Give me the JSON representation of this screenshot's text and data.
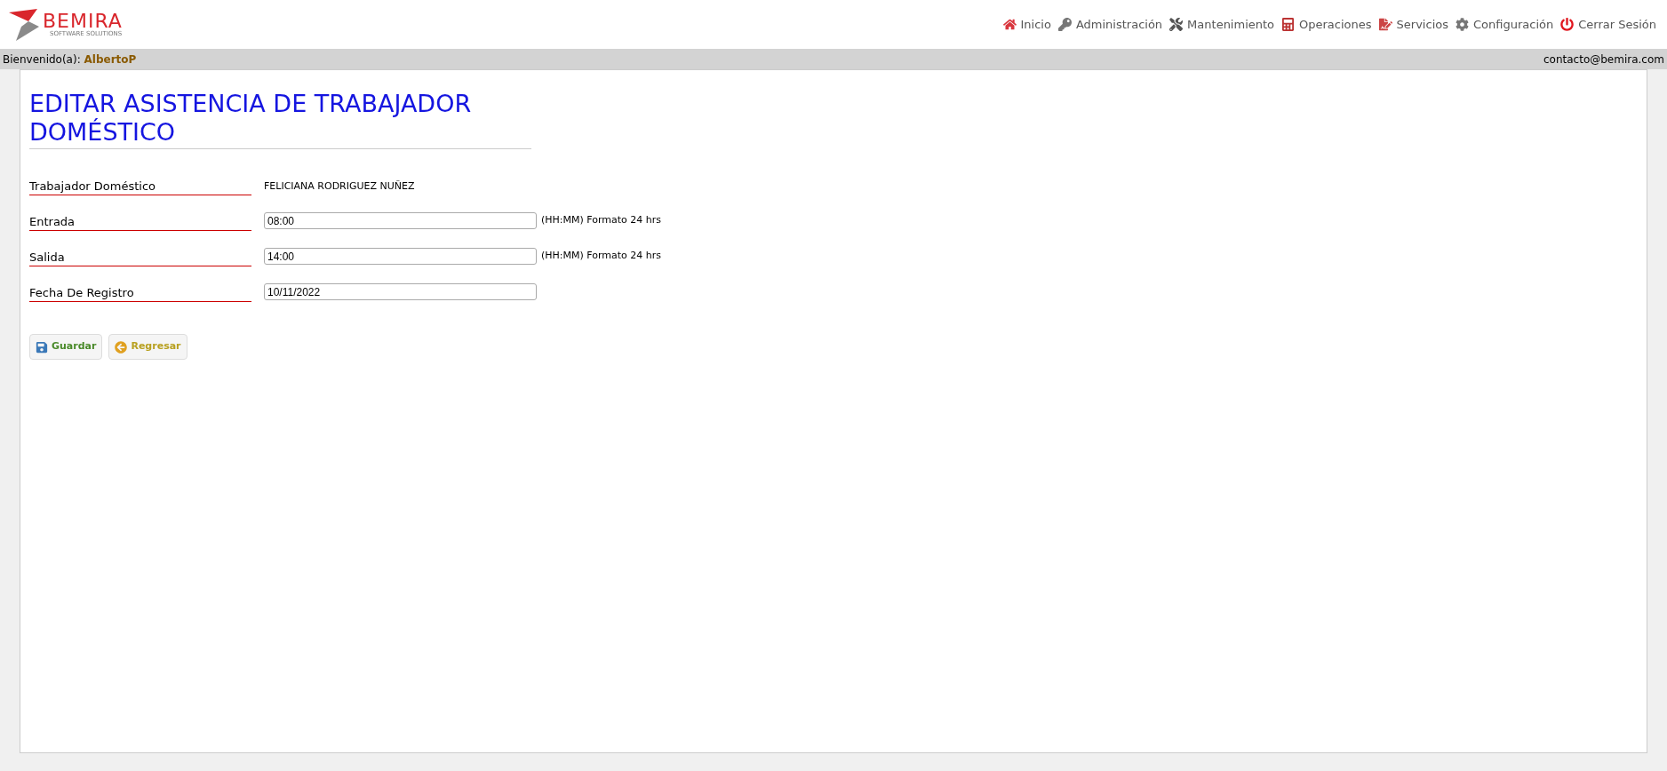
{
  "logo": {
    "name": "BEMIRA",
    "tagline": "SOFTWARE SOLUTIONS"
  },
  "nav": [
    {
      "label": "Inicio"
    },
    {
      "label": "Administración"
    },
    {
      "label": "Mantenimiento"
    },
    {
      "label": "Operaciones"
    },
    {
      "label": "Servicios"
    },
    {
      "label": "Configuración"
    },
    {
      "label": "Cerrar Sesión"
    }
  ],
  "user_bar": {
    "greeting": "Bienvenido(a):",
    "user": "AlbertoP",
    "email": "contacto@bemira.com"
  },
  "title": "EDITAR ASISTENCIA DE TRABAJADOR DOMÉSTICO",
  "fields": [
    {
      "kind": "text",
      "label": "Trabajador Doméstico",
      "value": "FELICIANA RODRIGUEZ NUÑEZ"
    },
    {
      "kind": "input",
      "label": "Entrada",
      "value": "08:00",
      "hint": "(HH:MM) Formato 24 hrs"
    },
    {
      "kind": "input",
      "label": "Salida",
      "value": "14:00",
      "hint": "(HH:MM) Formato 24 hrs"
    },
    {
      "kind": "input",
      "label": "Fecha De Registro",
      "value": "10/11/2022"
    }
  ],
  "buttons": [
    {
      "label": "Guardar",
      "kind": "save"
    },
    {
      "label": "Regresar",
      "kind": "back"
    }
  ]
}
